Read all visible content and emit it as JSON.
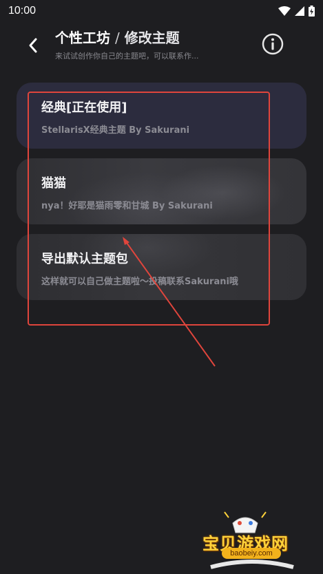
{
  "status_bar": {
    "time": "10:00"
  },
  "header": {
    "title_main": "个性工坊",
    "separator": "/",
    "title_sub": "修改主题",
    "subtitle": "来试试创作你自己的主题吧，可以联系作..."
  },
  "themes": [
    {
      "title": "经典[正在使用]",
      "description": "StellarisX经典主题 By Sakurani"
    },
    {
      "title": "猫猫",
      "description": "nya！好耶是猫雨零和甘城 By Sakurani"
    },
    {
      "title": "导出默认主题包",
      "description": "这样就可以自己做主题啦～投稿联系Sakurani哦"
    }
  ],
  "watermark": {
    "name": "宝贝游戏网",
    "url": "baobeiy.com"
  },
  "colors": {
    "background": "#1e1e21",
    "card_active": "#2c2c3e",
    "annotation_red": "#e0453c"
  },
  "icons": [
    "back-arrow-icon",
    "info-icon",
    "wifi-icon",
    "signal-icon",
    "battery-charging-icon"
  ]
}
